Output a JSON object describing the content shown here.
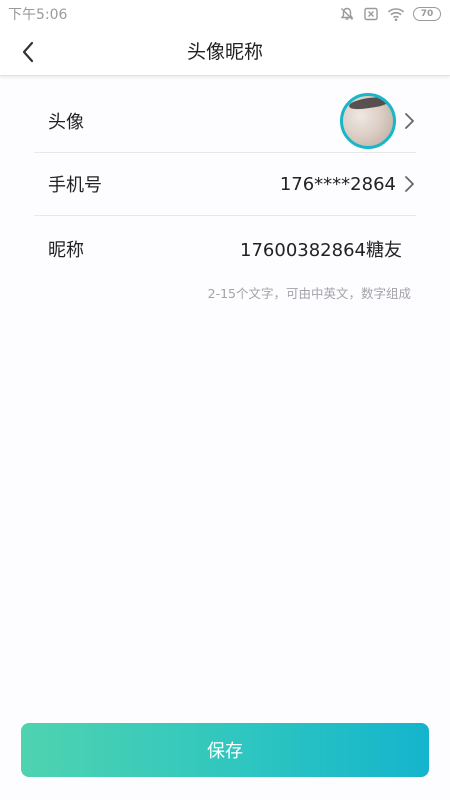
{
  "status_bar": {
    "time": "下午5:06",
    "icons": [
      "mute-icon",
      "sim-x-icon",
      "wifi-icon",
      "battery-icon"
    ],
    "battery_level": "70"
  },
  "header": {
    "title": "头像昵称",
    "back_icon": "chevron-left-icon"
  },
  "rows": {
    "avatar": {
      "label": "头像"
    },
    "phone": {
      "label": "手机号",
      "value": "176****2864"
    },
    "nickname": {
      "label": "昵称",
      "value": "17600382864糖友"
    }
  },
  "hint": "2-15个文字，可由中英文，数字组成",
  "save_button": {
    "label": "保存"
  },
  "colors": {
    "accent_start": "#4fd3b0",
    "accent_end": "#14b4cd",
    "avatar_border": "#18b6c9",
    "hint_text": "#a3a3a8"
  }
}
